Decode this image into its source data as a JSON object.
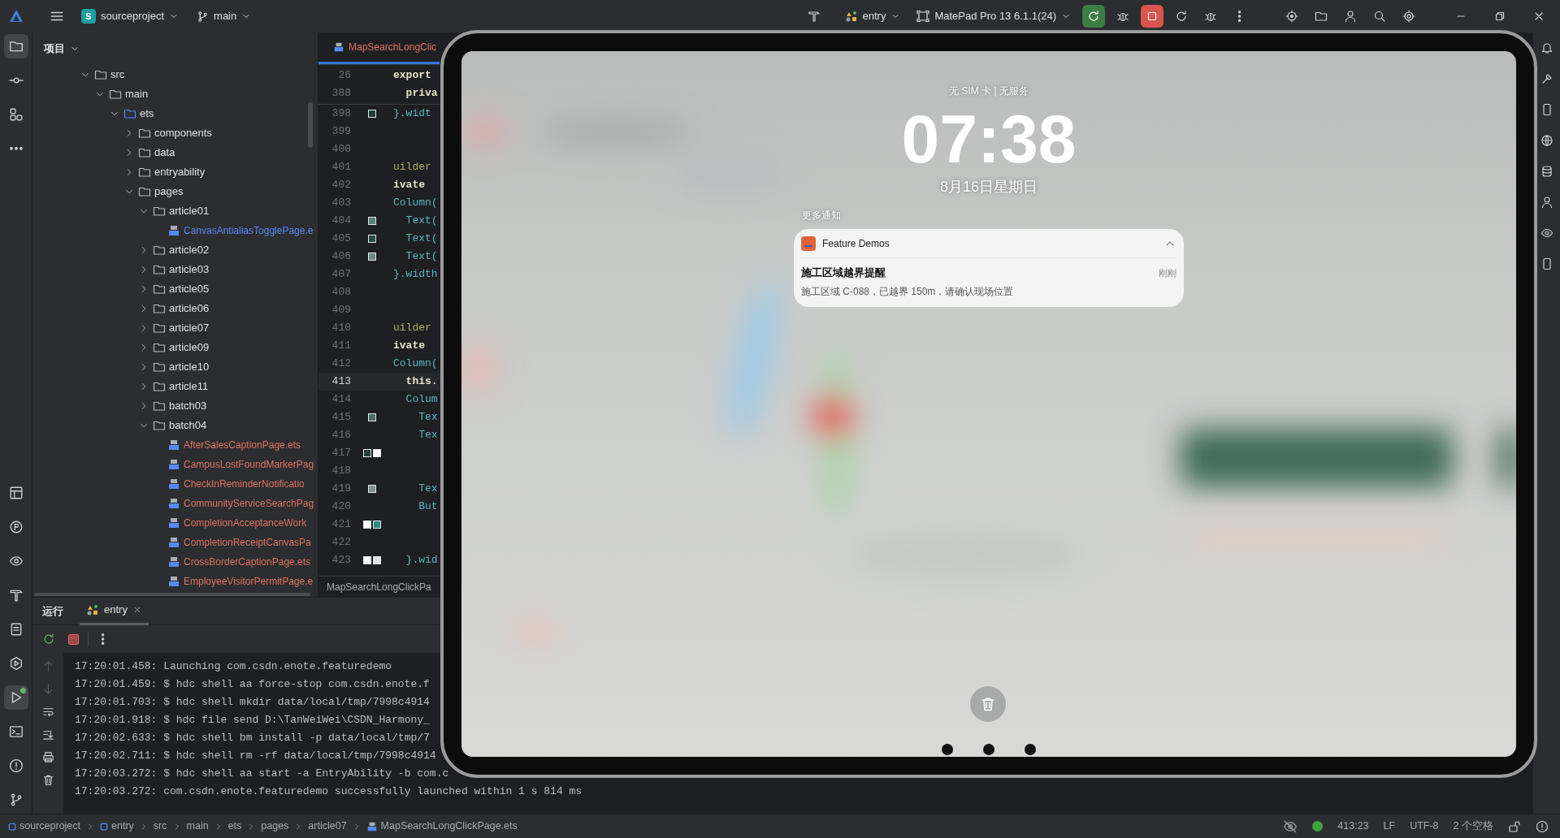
{
  "title_bar": {
    "project_badge": "S",
    "project": "sourceproject",
    "branch": "main",
    "run_config": "entry",
    "device": "MatePad Pro 13 6.1.1(24)"
  },
  "tool_strip": {
    "top": [
      {
        "selected": true
      },
      {
        "selected": false
      },
      {
        "selected": false
      },
      {
        "selected": false
      }
    ],
    "bottom": [
      {
        "selected": false
      },
      {
        "selected": false
      },
      {
        "selected": false
      },
      {
        "selected": false
      },
      {
        "selected": false
      },
      {
        "selected": false
      },
      {
        "selected": true
      },
      {
        "selected": false
      },
      {
        "selected": false
      },
      {
        "selected": false
      }
    ]
  },
  "project_panel": {
    "title": "项目",
    "tree": [
      {
        "label": "src",
        "kind": "folder",
        "expanded": true,
        "children": [
          {
            "label": "main",
            "kind": "folder",
            "expanded": true,
            "children": [
              {
                "label": "ets",
                "kind": "source_folder",
                "expanded": true,
                "children": [
                  {
                    "label": "components",
                    "kind": "folder",
                    "expanded": false
                  },
                  {
                    "label": "data",
                    "kind": "folder",
                    "expanded": false
                  },
                  {
                    "label": "entryability",
                    "kind": "folder",
                    "expanded": false
                  },
                  {
                    "label": "pages",
                    "kind": "folder",
                    "expanded": true,
                    "children": [
                      {
                        "label": "article01",
                        "kind": "folder",
                        "expanded": true,
                        "children": [
                          {
                            "label": "CanvasAntialiasTogglePage.e",
                            "kind": "file",
                            "color": "#548af7"
                          }
                        ]
                      },
                      {
                        "label": "article02",
                        "kind": "folder",
                        "expanded": false
                      },
                      {
                        "label": "article03",
                        "kind": "folder",
                        "expanded": false
                      },
                      {
                        "label": "article05",
                        "kind": "folder",
                        "expanded": false
                      },
                      {
                        "label": "article06",
                        "kind": "folder",
                        "expanded": false
                      },
                      {
                        "label": "article07",
                        "kind": "folder",
                        "expanded": false
                      },
                      {
                        "label": "article09",
                        "kind": "folder",
                        "expanded": false
                      },
                      {
                        "label": "article10",
                        "kind": "folder",
                        "expanded": false
                      },
                      {
                        "label": "article11",
                        "kind": "folder",
                        "expanded": false
                      },
                      {
                        "label": "batch03",
                        "kind": "folder",
                        "expanded": false
                      },
                      {
                        "label": "batch04",
                        "kind": "folder",
                        "expanded": true,
                        "children": [
                          {
                            "label": "AfterSalesCaptionPage.ets",
                            "kind": "file",
                            "color": "#e0735e"
                          },
                          {
                            "label": "CampusLostFoundMarkerPag",
                            "kind": "file",
                            "color": "#e0735e"
                          },
                          {
                            "label": "CheckInReminderNotificatio",
                            "kind": "file",
                            "color": "#e0735e"
                          },
                          {
                            "label": "CommunityServiceSearchPag",
                            "kind": "file",
                            "color": "#e0735e"
                          },
                          {
                            "label": "CompletionAcceptanceWork",
                            "kind": "file",
                            "color": "#e0735e"
                          },
                          {
                            "label": "CompletionReceiptCanvasPa",
                            "kind": "file",
                            "color": "#e0735e"
                          },
                          {
                            "label": "CrossBorderCaptionPage.ets",
                            "kind": "file",
                            "color": "#e0735e"
                          },
                          {
                            "label": "EmployeeVisitorPermitPage.e",
                            "kind": "file",
                            "color": "#e0735e"
                          }
                        ]
                      }
                    ]
                  }
                ]
              }
            ]
          }
        ]
      }
    ]
  },
  "editor": {
    "tab": "MapSearchLongClic",
    "sticky": [
      {
        "line": "26",
        "code": "export",
        "kind": "keyword"
      },
      {
        "line": "388",
        "code": "  priva",
        "kind": "keyword"
      }
    ],
    "lines": [
      {
        "line": "398",
        "code": "}.widt",
        "kind": "call",
        "current": false,
        "swatches": [
          {
            "color": "#1f3d3a"
          }
        ]
      },
      {
        "line": "399",
        "current": false
      },
      {
        "line": "400",
        "current": false
      },
      {
        "line": "401",
        "code": "uilder",
        "kind": "annotation",
        "current": false
      },
      {
        "line": "402",
        "code": "ivate",
        "kind": "keyword",
        "current": false
      },
      {
        "line": "403",
        "code": "Column(",
        "kind": "call",
        "current": false
      },
      {
        "line": "404",
        "code": "  Text(",
        "kind": "call",
        "current": false,
        "swatches": [
          {
            "color": "#5d8079"
          }
        ]
      },
      {
        "line": "405",
        "code": "  Text(",
        "kind": "call",
        "current": false,
        "swatches": [
          {
            "color": "#1f4a44"
          }
        ]
      },
      {
        "line": "406",
        "code": "  Text(",
        "kind": "call",
        "current": false,
        "swatches": [
          {
            "color": "#6c8a84"
          }
        ]
      },
      {
        "line": "407",
        "code": "}.width",
        "kind": "call",
        "current": false
      },
      {
        "line": "408",
        "current": false
      },
      {
        "line": "409",
        "current": false
      },
      {
        "line": "410",
        "code": "uilder",
        "kind": "annotation",
        "current": false
      },
      {
        "line": "411",
        "code": "ivate",
        "kind": "keyword",
        "current": false
      },
      {
        "line": "412",
        "code": "Column(",
        "kind": "call",
        "current": false
      },
      {
        "line": "413",
        "code": "  this.",
        "kind": "keyword",
        "current": true
      },
      {
        "line": "414",
        "code": "  Colum",
        "kind": "call",
        "current": false
      },
      {
        "line": "415",
        "code": "    Tex",
        "kind": "call",
        "current": false,
        "swatches": [
          {
            "color": "#4b6b66"
          }
        ]
      },
      {
        "line": "416",
        "code": "    Tex",
        "kind": "call",
        "current": false
      },
      {
        "line": "417",
        "current": false,
        "swatches": [
          {
            "color": "#1f3f3c"
          },
          {
            "color": "#ffffff"
          }
        ]
      },
      {
        "line": "418",
        "current": false
      },
      {
        "line": "419",
        "code": "    Tex",
        "kind": "call",
        "current": false,
        "swatches": [
          {
            "color": "#7f8f8c"
          }
        ]
      },
      {
        "line": "420",
        "code": "    But",
        "kind": "call",
        "current": false
      },
      {
        "line": "421",
        "current": false,
        "swatches": [
          {
            "color": "#ffffff"
          },
          {
            "color": "#2e8a7a"
          }
        ]
      },
      {
        "line": "422",
        "current": false
      },
      {
        "line": "423",
        "code": "  }.wid",
        "kind": "call",
        "current": false,
        "swatches": [
          {
            "color": "#ffffff"
          },
          {
            "color": "#dde3e2"
          }
        ]
      }
    ],
    "breadcrumb": "MapSearchLongClickPa"
  },
  "run_panel": {
    "title": "运行",
    "tabs": [
      {
        "label": "entry",
        "selected": true
      }
    ],
    "console": [
      "17:20:01.458: Launching com.csdn.enote.featuredemo",
      "17:20:01.459: $ hdc shell aa force-stop com.csdn.enote.f",
      "17:20:01.703: $ hdc shell mkdir data/local/tmp/7998c4914",
      "17:20:01.918: $ hdc file send D:\\TanWeiWei\\CSDN_Harmony_",
      "17:20:02.633: $ hdc shell bm install -p data/local/tmp/7",
      "17:20:02.711: $ hdc shell rm -rf data/local/tmp/7998c4914",
      "17:20:03.272: $ hdc shell aa start -a EntryAbility -b com.c",
      "17:20:03.272: com.csdn.enote.featuredemo successfully launched within 1 s 814 ms"
    ]
  },
  "status_bar": {
    "breadcrumbs": [
      {
        "label": "sourceproject",
        "kind": "module"
      },
      {
        "label": "entry",
        "kind": "module"
      },
      {
        "label": "src",
        "kind": "folder"
      },
      {
        "label": "main",
        "kind": "folder"
      },
      {
        "label": "ets",
        "kind": "folder"
      },
      {
        "label": "pages",
        "kind": "folder"
      },
      {
        "label": "article07",
        "kind": "folder"
      },
      {
        "label": "MapSearchLongClickPage.ets",
        "kind": "file"
      }
    ],
    "position": "413:23",
    "line_ending": "LF",
    "encoding": "UTF-8",
    "indent": "2 个空格"
  },
  "device": {
    "status": "无 SIM 卡 | 无服务",
    "time": "07:38",
    "date": "8月16日星期日",
    "section": "更多通知",
    "notification": {
      "app": "Feature Demos",
      "expanded": true,
      "title": "施工区域越界提醒",
      "time": "刚刚",
      "body": "施工区域 C-088，已越界 150m，请确认现场位置"
    }
  }
}
